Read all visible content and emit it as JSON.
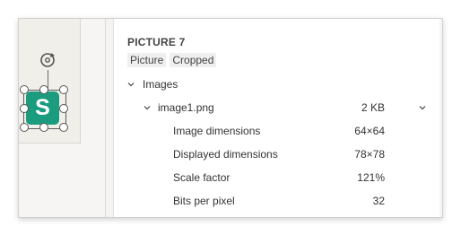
{
  "canvas": {
    "image_letter": "S",
    "image_color": "#1c9c7e"
  },
  "panel": {
    "title": "PICTURE 7",
    "tags": [
      "Picture",
      "Cropped"
    ],
    "section_label": "Images",
    "file": {
      "name": "image1.png",
      "size": "2 KB"
    },
    "props": [
      {
        "label": "Image dimensions",
        "value": "64×64"
      },
      {
        "label": "Displayed dimensions",
        "value": "78×78"
      },
      {
        "label": "Scale factor",
        "value": "121%"
      },
      {
        "label": "Bits per pixel",
        "value": "32"
      }
    ]
  }
}
